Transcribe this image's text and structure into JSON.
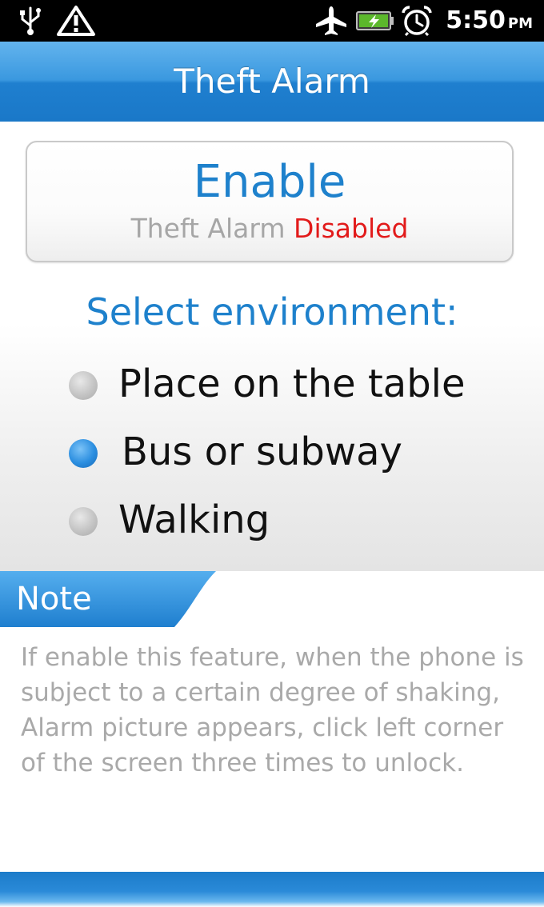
{
  "status_bar": {
    "time": "5:50",
    "ampm": "PM",
    "icons": [
      "usb-icon",
      "warning-icon",
      "airplane-icon",
      "battery-charging-icon",
      "alarm-clock-icon"
    ]
  },
  "header": {
    "title": "Theft Alarm"
  },
  "enable_button": {
    "label": "Enable",
    "status_prefix": "Theft Alarm",
    "status_value": "Disabled"
  },
  "environment": {
    "heading": "Select environment:",
    "options": [
      {
        "label": "Place on the table",
        "selected": false
      },
      {
        "label": "Bus or subway",
        "selected": true
      },
      {
        "label": "Walking",
        "selected": false
      }
    ]
  },
  "note": {
    "title": "Note",
    "text": "If enable this feature, when the phone is subject to a certain degree of shaking, Alarm picture appears, click left corner of the screen three times to unlock."
  },
  "colors": {
    "accent": "#1e81cc",
    "disabled": "#e21b1b",
    "muted_text": "#a9a9a9"
  }
}
